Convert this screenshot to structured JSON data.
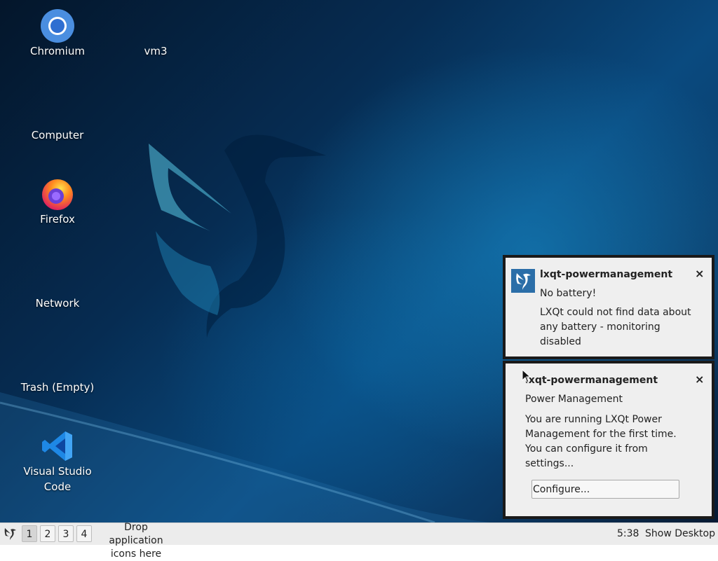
{
  "desktop_icons": {
    "chromium": "Chromium",
    "vm3": "vm3",
    "computer": "Computer",
    "firefox": "Firefox",
    "network": "Network",
    "trash": "Trash (Empty)",
    "vscode_line1": "Visual Studio",
    "vscode_line2": "Code"
  },
  "notifications": [
    {
      "title": "lxqt-powermanagement",
      "summary": "No battery!",
      "body_lines": [
        "LXQt could not find data about",
        "any battery - monitoring",
        "disabled"
      ],
      "close": "×"
    },
    {
      "title": "lxqt-powermanagement",
      "summary": "Power Management",
      "body_lines": [
        "You are running LXQt Power",
        "Management for the first time.",
        "You can configure it from",
        "settings..."
      ],
      "button": "Configure...",
      "close": "×"
    }
  ],
  "taskbar": {
    "workspaces": [
      "1",
      "2",
      "3",
      "4"
    ],
    "active_workspace": "1",
    "drop_line1": "Drop application",
    "drop_line2": "icons here",
    "clock": "5:38",
    "show_desktop": "Show Desktop"
  },
  "colors": {
    "wallpaper_dark": "#04162b",
    "wallpaper_mid": "#0a4a7f",
    "notification_bg": "#efefef",
    "taskbar_bg": "#ececec"
  }
}
